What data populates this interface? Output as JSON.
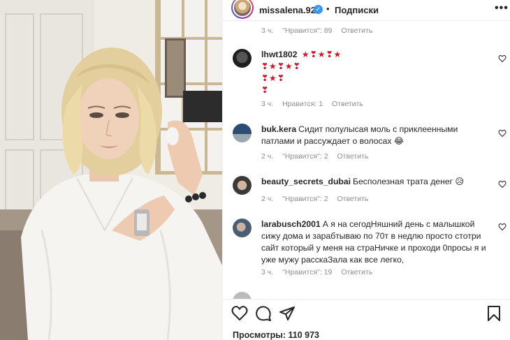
{
  "header": {
    "username": "missalena.92",
    "verified_glyph": "✓",
    "dot": "•",
    "follow_label": "Подписки",
    "more_glyph": "•••"
  },
  "comments": [
    {
      "meta": {
        "time": "3 ч.",
        "likes": "\"Нравится\": 89",
        "reply": "Ответить"
      }
    },
    {
      "username": "lhwt1802",
      "text_line1": "★❣★❣★",
      "text_line2": "❣★❣★❣",
      "text_line3": "❣★❣",
      "text_line4": "❣",
      "meta": {
        "time": "3 ч.",
        "likes": "Нравится: 1",
        "reply": "Ответить"
      }
    },
    {
      "username": "buk.kera",
      "text": "Сидит полулысая моль с приклеенными патлами и рассуждает о волосах 😂",
      "meta": {
        "time": "2 ч.",
        "likes": "\"Нравится\": 2",
        "reply": "Ответить"
      }
    },
    {
      "username": "beauty_secrets_dubai",
      "text": "Бесполезная трата денег 😥",
      "meta": {
        "time": "2 ч.",
        "likes": "\"Нравится\": 2",
        "reply": "Ответить"
      }
    },
    {
      "username": "larabusch2001",
      "text": "А я на сегодНяшний день с малышкой сижу дома и зарабтываю по 70т в недлю просто стотри сайт который у меня на страНичке и проходи 0просы я и уже мужу расскаЗала как все легко,",
      "meta": {
        "time": "3 ч.",
        "likes": "\"Нравится\": 19",
        "reply": "Ответить"
      }
    }
  ],
  "icons": {
    "like": "heart-icon",
    "comment": "comment-icon",
    "share": "share-icon",
    "save": "bookmark-icon",
    "comment_like": "heart-outline-icon"
  },
  "views": "Просмотры: 110 973",
  "colors": {
    "text": "#262626",
    "muted": "#8e8e8e",
    "verified": "#3897f0",
    "border": "#efefef"
  }
}
